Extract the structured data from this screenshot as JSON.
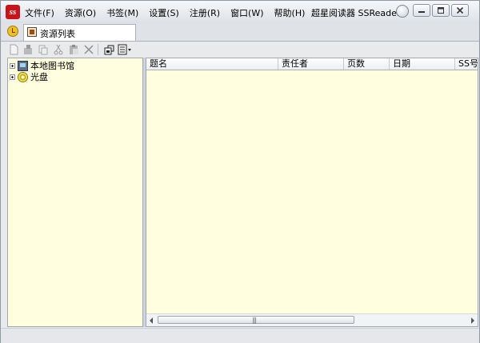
{
  "menubar": {
    "items": [
      {
        "label": "文件(F)"
      },
      {
        "label": "资源(O)"
      },
      {
        "label": "书签(M)"
      },
      {
        "label": "设置(S)"
      },
      {
        "label": "注册(R)"
      },
      {
        "label": "窗口(W)"
      },
      {
        "label": "帮助(H)"
      }
    ],
    "app_title": "超星阅读器 SSReader"
  },
  "tabs": [
    {
      "label": "资源列表"
    }
  ],
  "toolbar": {
    "buttons": [
      "new-icon",
      "import-icon",
      "copy-icon",
      "cut-icon",
      "paste-icon",
      "delete-icon",
      "open-icon",
      "view-icon"
    ]
  },
  "tree": {
    "nodes": [
      {
        "label": "本地图书馆",
        "icon": "computer-icon"
      },
      {
        "label": "光盘",
        "icon": "cd-icon"
      }
    ]
  },
  "list": {
    "columns": [
      "题名",
      "责任者",
      "页数",
      "日期",
      "SS号"
    ],
    "rows": []
  },
  "colors": {
    "panel_bg": "#ffffdf",
    "window_bg": "#e9eaec",
    "brand_red": "#c7141a"
  }
}
